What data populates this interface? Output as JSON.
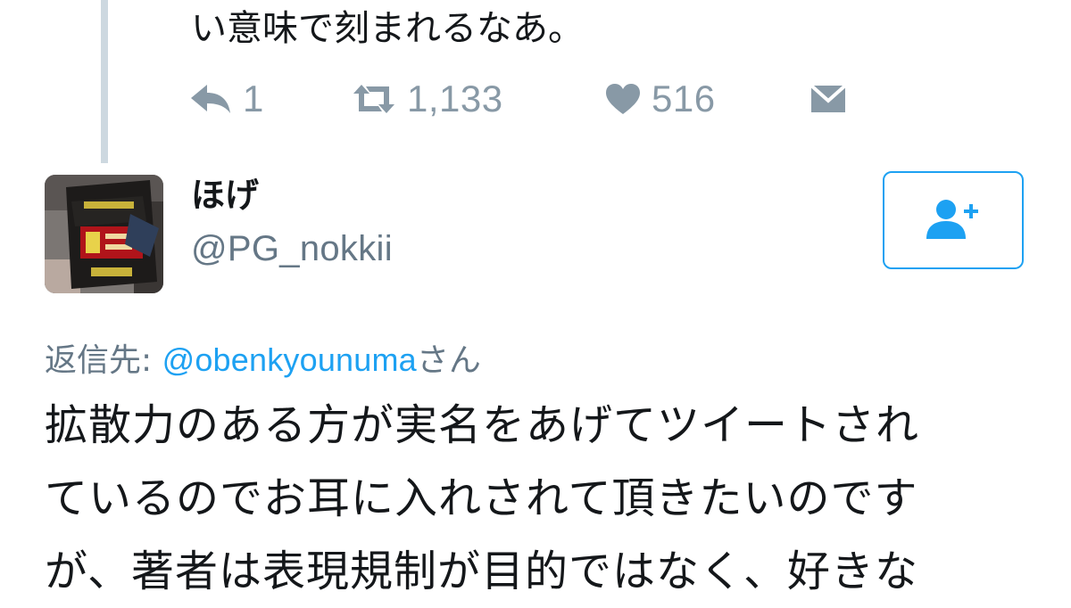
{
  "previous_tweet": {
    "text_tail": "い意味で刻まれるなあ。",
    "actions": {
      "reply_count": "1",
      "retweet_count": "1,133",
      "like_count": "516",
      "reply_icon": "reply-icon",
      "retweet_icon": "retweet-icon",
      "like_icon": "heart-icon",
      "dm_icon": "envelope-icon"
    }
  },
  "tweet": {
    "display_name": "ほげ",
    "handle": "@PG_nokkii",
    "follow_icon": "add-user-icon",
    "reply_prefix": "返信先: ",
    "reply_mention": "@obenkyounuma",
    "reply_suffix": "さん",
    "body_lines": [
      "拡散力のある方が実名をあげてツイートされ",
      "ているのでお耳に入れされて頂きたいのです",
      "が、著者は表現規制が目的ではなく、好きな"
    ]
  },
  "colors": {
    "accent": "#1da1f2",
    "secondary_text": "#657786",
    "icon_gray": "#8899a6",
    "thread_line": "#cdd8e0"
  }
}
